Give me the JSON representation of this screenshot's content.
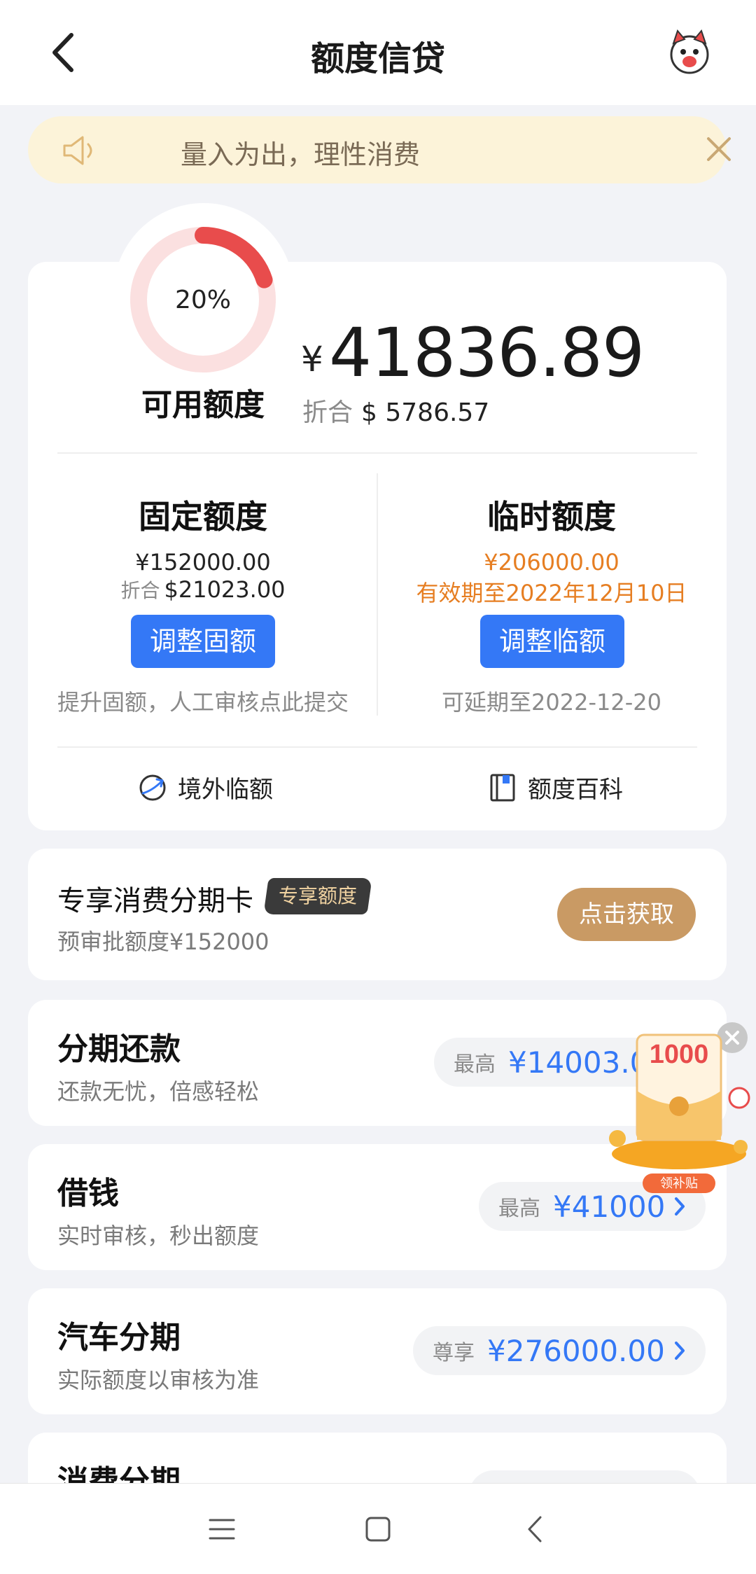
{
  "header": {
    "title": "额度信贷",
    "back_icon": "chevron-left-icon",
    "mascot_icon": "mascot-avatar-icon"
  },
  "notice": {
    "text": "量入为出，理性消费",
    "speaker_icon": "speaker-icon",
    "close_icon": "close-icon"
  },
  "credit": {
    "usage_percent_label": "20%",
    "usage_fraction": 0.2,
    "available_label": "可用额度",
    "currency_symbol": "¥",
    "available_amount": "41836.89",
    "equiv_label": "折合",
    "equiv_amount": "$ 5786.57"
  },
  "fixed": {
    "title": "固定额度",
    "amount": "¥152000.00",
    "equiv_label": "折合",
    "equiv_amount": "$21023.00",
    "button": "调整固额",
    "note": "提升固额，人工审核点此提交"
  },
  "temp": {
    "title": "临时额度",
    "amount": "¥206000.00",
    "validity": "有效期至2022年12月10日",
    "button": "调整临额",
    "note": "可延期至2022-12-20"
  },
  "links": {
    "overseas": "境外临额",
    "wiki": "额度百科"
  },
  "exclusive": {
    "title": "专享消费分期卡",
    "badge": "专享额度",
    "sub": "预审批额度¥152000",
    "button": "点击获取"
  },
  "loans": [
    {
      "title": "分期还款",
      "sub": "还款无忧，倍感轻松",
      "pill_label": "最高",
      "pill_value": "¥14003.00"
    },
    {
      "title": "借钱",
      "sub": "实时审核，秒出额度",
      "pill_label": "最高",
      "pill_value": "¥41000"
    },
    {
      "title": "汽车分期",
      "sub": "实际额度以审核为准",
      "pill_label": "尊享",
      "pill_value": "¥276000.00"
    },
    {
      "title": "消费分期",
      "sub": "",
      "pill_label": "",
      "pill_value": ""
    }
  ],
  "promo": {
    "amount": "1000",
    "tag": "领补贴"
  },
  "colors": {
    "accent_blue": "#3478f6",
    "orange": "#e67e22",
    "ring_red": "#e84c4c",
    "gold": "#c99a64"
  }
}
